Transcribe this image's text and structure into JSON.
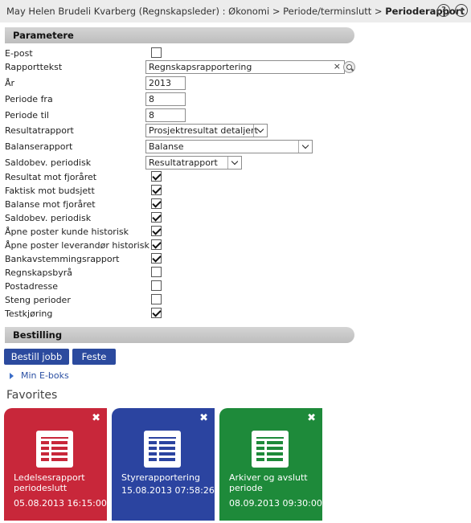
{
  "breadcrumb": {
    "user": "May Helen Brudeli Kvarberg (Regnskapsleder) :",
    "level1": "Økonomi",
    "level2": "Periode/terminslutt",
    "current": "Perioderapport",
    "sep": ">"
  },
  "top_icons": {
    "help": "?",
    "pin": "pin-icon"
  },
  "parametere": {
    "title": "Parametere",
    "epost_label": "E-post",
    "rapporttekst_label": "Rapporttekst",
    "rapporttekst_value": "Regnskapsrapportering",
    "clear": "×",
    "aar_label": "År",
    "aar_value": "2013",
    "periode_fra_label": "Periode fra",
    "periode_fra_value": "8",
    "periode_til_label": "Periode til",
    "periode_til_value": "8",
    "resultatrapport_label": "Resultatrapport",
    "resultatrapport_value": "Prosjektresultat detaljert",
    "balanserapport_label": "Balanserapport",
    "balanserapport_value": "Balanse",
    "saldobev_label": "Saldobev. periodisk",
    "saldobev_value": "Resultatrapport",
    "checks": [
      {
        "label": "Resultat mot fjoråret",
        "checked": true
      },
      {
        "label": "Faktisk mot budsjett",
        "checked": true
      },
      {
        "label": "Balanse mot fjoråret",
        "checked": true
      },
      {
        "label": "Saldobev. periodisk",
        "checked": true
      },
      {
        "label": "Åpne poster kunde historisk",
        "checked": true
      },
      {
        "label": "Åpne poster leverandør historisk",
        "checked": true
      },
      {
        "label": "Bankavstemmingsrapport",
        "checked": true
      },
      {
        "label": "Regnskapsbyrå",
        "checked": false
      },
      {
        "label": "Postadresse",
        "checked": false
      },
      {
        "label": "Steng perioder",
        "checked": false
      },
      {
        "label": "Testkjøring",
        "checked": true
      }
    ]
  },
  "bestilling": {
    "title": "Bestilling",
    "order_button": "Bestill jobb",
    "pin_button": "Feste",
    "ebox_link": "Min E-boks"
  },
  "favorites": {
    "title": "Favorites",
    "close": "✖",
    "tiles": [
      {
        "title": "Ledelsesrapport periodeslutt",
        "date": "05.08.2013 16:15:00",
        "color": "#c8273a"
      },
      {
        "title": "Styrerapportering",
        "date": "15.08.2013 07:58:26",
        "color": "#2b44a0"
      },
      {
        "title": "Arkiver og avslutt periode",
        "date": "08.09.2013 09:30:00",
        "color": "#1e8a3a"
      }
    ]
  },
  "colors": {
    "accent": "#2b4a9e",
    "header_gray": "#c8c8c8"
  }
}
